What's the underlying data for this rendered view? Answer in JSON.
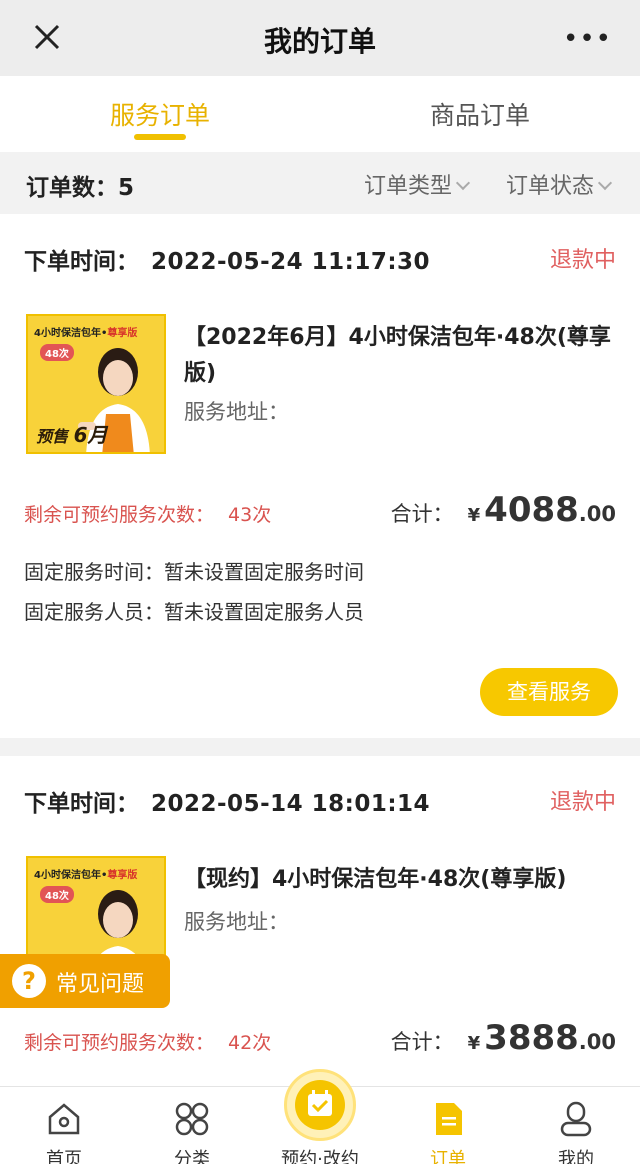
{
  "header": {
    "title": "我的订单",
    "close_icon": "close-icon",
    "more_label": "•••"
  },
  "tabs": [
    {
      "label": "服务订单",
      "active": true
    },
    {
      "label": "商品订单",
      "active": false
    }
  ],
  "filters": {
    "count_label": "订单数：",
    "count_value": "5",
    "order_type": "订单类型",
    "order_status": "订单状态"
  },
  "orders": [
    {
      "time_label": "下单时间：",
      "time": "2022-05-24 11:17:30",
      "status": "退款中",
      "title": "【2022年6月】4小时保洁包年·48次(尊享版)",
      "address_label": "服务地址：",
      "remaining_label": "剩余可预约服务次数：",
      "remaining_value": "43次",
      "total_label": "合计：",
      "currency": "¥",
      "amount_int": "4088",
      "amount_dec": ".00",
      "fixed_time_label": "固定服务时间：",
      "fixed_time_value": "暂未设置固定服务时间",
      "fixed_staff_label": "固定服务人员：",
      "fixed_staff_value": "暂未设置固定服务人员",
      "button_label": "查看服务",
      "thumb": {
        "top": "4小时保洁包年",
        "vip": "尊享版",
        "badge": "48次",
        "bottom_pre": "预售",
        "bottom_num": "6月"
      }
    },
    {
      "time_label": "下单时间：",
      "time": "2022-05-14 18:01:14",
      "status": "退款中",
      "title": "【现约】4小时保洁包年·48次(尊享版)",
      "address_label": "服务地址：",
      "remaining_label": "剩余可预约服务次数：",
      "remaining_value": "42次",
      "total_label": "合计：",
      "currency": "¥",
      "amount_int": "3888",
      "amount_dec": ".00",
      "thumb": {
        "top": "4小时保洁包年",
        "vip": "尊享版",
        "badge": "48次"
      }
    }
  ],
  "faq": {
    "label": "常见问题"
  },
  "bottom_nav": [
    {
      "label": "首页",
      "icon": "home-icon"
    },
    {
      "label": "分类",
      "icon": "category-icon"
    },
    {
      "label": "预约·改约",
      "icon": "calendar-check-icon"
    },
    {
      "label": "订单",
      "icon": "order-doc-icon",
      "active": true
    },
    {
      "label": "我的",
      "icon": "profile-icon"
    }
  ],
  "colors": {
    "accent": "#f5c400",
    "status_red": "#e06060",
    "faq_orange": "#f0a000"
  }
}
